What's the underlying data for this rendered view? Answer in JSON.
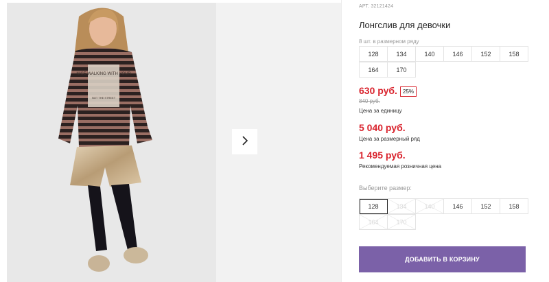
{
  "product": {
    "article_label": "АРТ.",
    "article": "32121424",
    "title": "Лонгслив для девочки",
    "series_note": "8 шт. в размерном ряду",
    "series_sizes": [
      "128",
      "134",
      "140",
      "146",
      "152",
      "158",
      "164",
      "170"
    ],
    "shirt_print_text": "NICE WALKING WITH YOUR",
    "print_small_text": "NOT THE STREET"
  },
  "pricing": {
    "unit_price": "630 руб.",
    "discount": "25%",
    "old_price": "840 руб.",
    "unit_price_label": "Цена за единицу",
    "series_price": "5 040 руб.",
    "series_price_label": "Цена за размерный ряд",
    "retail_price": "1 495 руб.",
    "retail_price_label": "Рекомендуемая розничная цена"
  },
  "size_select": {
    "label": "Выберите размер:",
    "options": [
      {
        "size": "128",
        "state": "selected"
      },
      {
        "size": "134",
        "state": "unavailable"
      },
      {
        "size": "140",
        "state": "unavailable"
      },
      {
        "size": "146",
        "state": "available"
      },
      {
        "size": "152",
        "state": "available"
      },
      {
        "size": "158",
        "state": "available"
      },
      {
        "size": "164",
        "state": "unavailable"
      },
      {
        "size": "170",
        "state": "unavailable"
      }
    ]
  },
  "actions": {
    "add_to_cart": "ДОБАВИТЬ В КОРЗИНУ",
    "next_photo_icon": "chevron-right-icon"
  },
  "colors": {
    "price_red": "#d9232d",
    "button_purple": "#7b61a8"
  }
}
